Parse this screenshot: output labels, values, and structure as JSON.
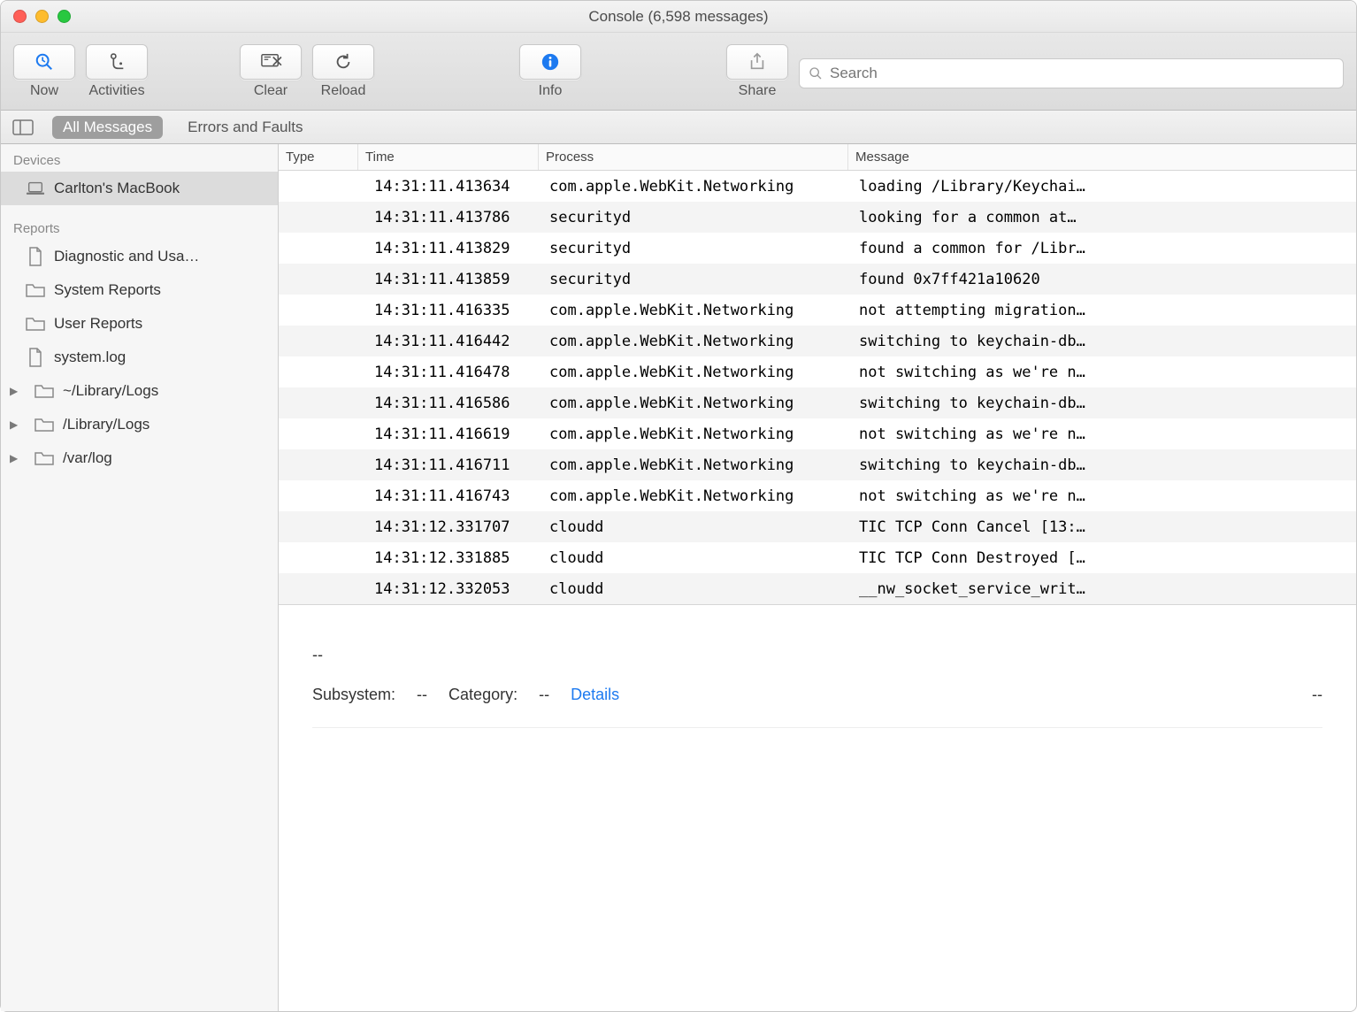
{
  "title": "Console (6,598 messages)",
  "toolbar": {
    "now": "Now",
    "activities": "Activities",
    "clear": "Clear",
    "reload": "Reload",
    "info": "Info",
    "share": "Share",
    "search_placeholder": "Search"
  },
  "filter": {
    "all_messages": "All Messages",
    "errors_faults": "Errors and Faults"
  },
  "sidebar": {
    "devices_header": "Devices",
    "device_name": "Carlton's MacBook",
    "reports_header": "Reports",
    "items": [
      {
        "label": "Diagnostic and Usa…",
        "icon": "document"
      },
      {
        "label": "System Reports",
        "icon": "folder"
      },
      {
        "label": "User Reports",
        "icon": "folder"
      },
      {
        "label": "system.log",
        "icon": "document"
      },
      {
        "label": "~/Library/Logs",
        "icon": "folder",
        "disclosure": true
      },
      {
        "label": "/Library/Logs",
        "icon": "folder",
        "disclosure": true
      },
      {
        "label": "/var/log",
        "icon": "folder",
        "disclosure": true
      }
    ]
  },
  "columns": [
    "Type",
    "Time",
    "Process",
    "Message"
  ],
  "rows": [
    {
      "time": "14:31:11.413634",
      "process": "com.apple.WebKit.Networking",
      "message": "loading /Library/Keychai…"
    },
    {
      "time": "14:31:11.413786",
      "process": "securityd",
      "message": "looking for a common at…"
    },
    {
      "time": "14:31:11.413829",
      "process": "securityd",
      "message": "found a common for /Libr…"
    },
    {
      "time": "14:31:11.413859",
      "process": "securityd",
      "message": "found 0x7ff421a10620"
    },
    {
      "time": "14:31:11.416335",
      "process": "com.apple.WebKit.Networking",
      "message": "not attempting migration…"
    },
    {
      "time": "14:31:11.416442",
      "process": "com.apple.WebKit.Networking",
      "message": "switching to keychain-db…"
    },
    {
      "time": "14:31:11.416478",
      "process": "com.apple.WebKit.Networking",
      "message": "not switching as we're n…"
    },
    {
      "time": "14:31:11.416586",
      "process": "com.apple.WebKit.Networking",
      "message": "switching to keychain-db…"
    },
    {
      "time": "14:31:11.416619",
      "process": "com.apple.WebKit.Networking",
      "message": "not switching as we're n…"
    },
    {
      "time": "14:31:11.416711",
      "process": "com.apple.WebKit.Networking",
      "message": "switching to keychain-db…"
    },
    {
      "time": "14:31:11.416743",
      "process": "com.apple.WebKit.Networking",
      "message": "not switching as we're n…"
    },
    {
      "time": "14:31:12.331707",
      "process": "cloudd",
      "message": "TIC TCP Conn Cancel [13:…"
    },
    {
      "time": "14:31:12.331885",
      "process": "cloudd",
      "message": "TIC TCP Conn Destroyed […"
    },
    {
      "time": "14:31:12.332053",
      "process": "cloudd",
      "message": "__nw_socket_service_writ…"
    }
  ],
  "detail": {
    "dashes": "--",
    "subsystem_label": "Subsystem:",
    "subsystem_value": "--",
    "category_label": "Category:",
    "category_value": "--",
    "details_link": "Details",
    "right": "--"
  }
}
